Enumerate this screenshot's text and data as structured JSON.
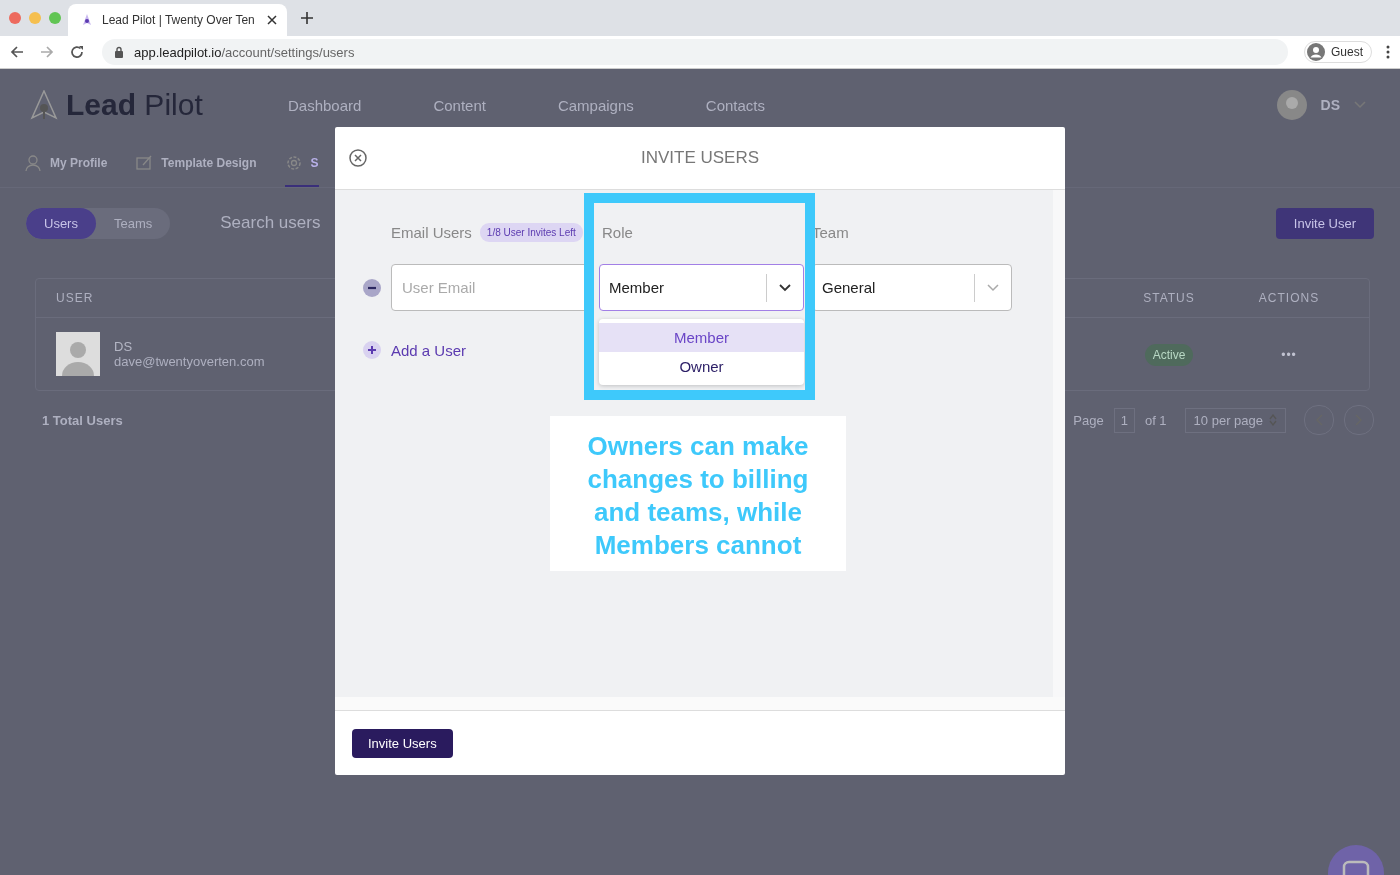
{
  "browser": {
    "tab_title": "Lead Pilot | Twenty Over Ten",
    "url_host": "app.leadpilot.io",
    "url_path": "/account/settings/users",
    "profile": "Guest"
  },
  "app": {
    "logo": {
      "bold": "Lead",
      "light": "Pilot"
    },
    "nav": [
      "Dashboard",
      "Content",
      "Campaigns",
      "Contacts"
    ],
    "user_initials": "DS",
    "subtabs": [
      {
        "label": "My Profile",
        "selected": false
      },
      {
        "label": "Template Design",
        "selected": false
      },
      {
        "label": "S",
        "selected": true
      }
    ],
    "segments": [
      {
        "label": "Users",
        "selected": true
      },
      {
        "label": "Teams",
        "selected": false
      }
    ],
    "search": {
      "placeholder": "Search users"
    },
    "invite_button": "Invite User",
    "table": {
      "columns": [
        "USER",
        "STATUS",
        "ACTIONS"
      ],
      "rows": [
        {
          "name": "DS",
          "email": "dave@twentyoverten.com",
          "status": "Active",
          "actions": "•••"
        }
      ]
    },
    "footer": {
      "total": "1 Total Users",
      "page_label": "Page",
      "page": "1",
      "of": "of 1",
      "per_page": "10 per page"
    }
  },
  "modal": {
    "title": "INVITE USERS",
    "email_label": "Email Users",
    "badge": "1/8 User Invites Left",
    "role_label": "Role",
    "team_label": "Team",
    "email_placeholder": "User Email",
    "role_value": "Member",
    "team_value": "General",
    "role_options": [
      {
        "label": "Member",
        "selected": true
      },
      {
        "label": "Owner",
        "selected": false
      }
    ],
    "add_user": "Add a User",
    "submit": "Invite Users"
  },
  "annotation": {
    "text": "Owners can make changes to billing and teams, while Members cannot"
  }
}
